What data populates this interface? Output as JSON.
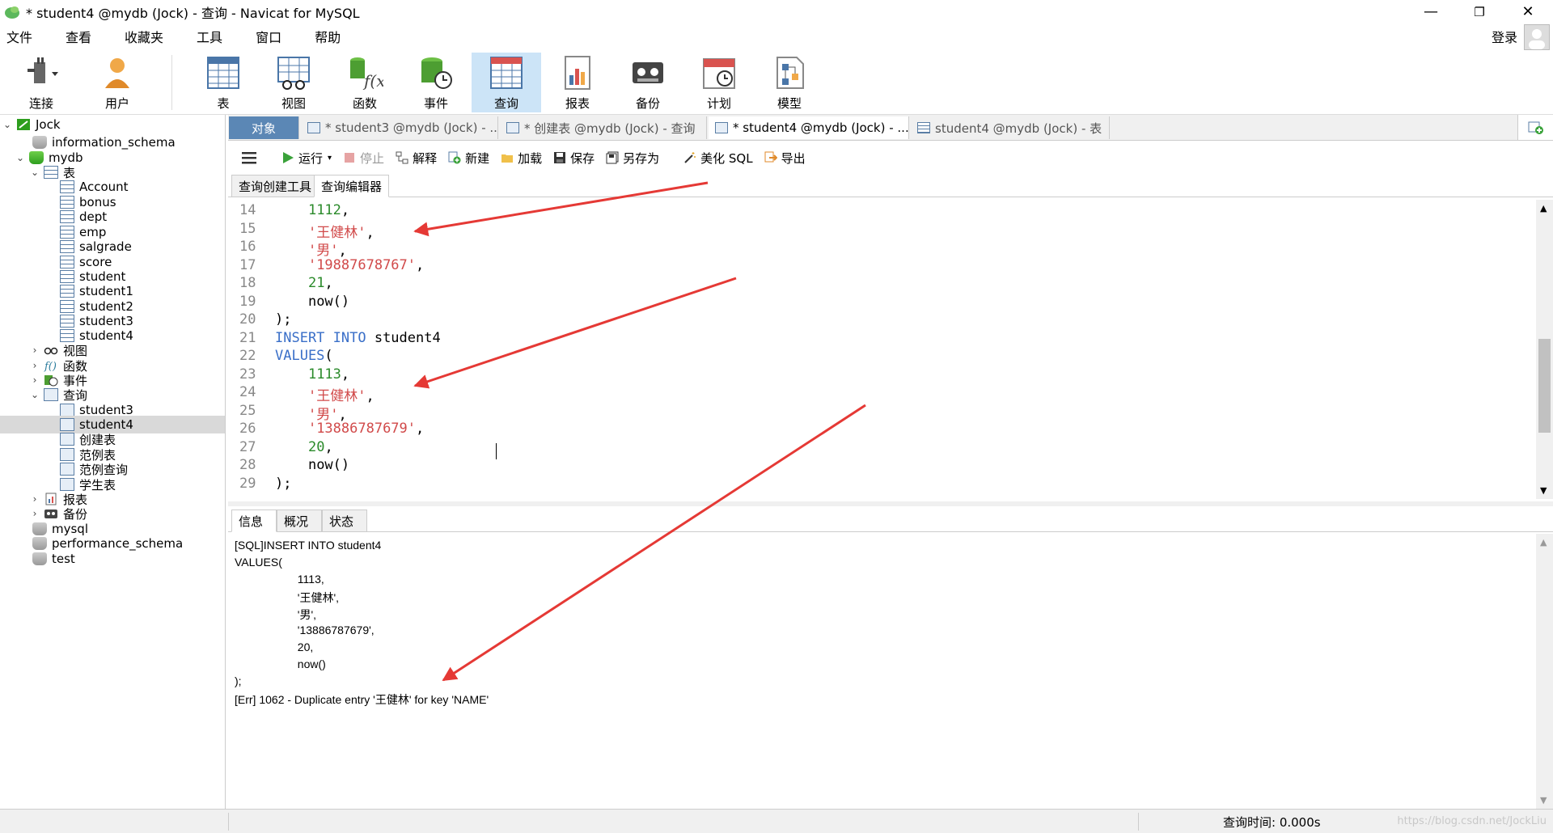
{
  "window": {
    "title": "* student4 @mydb (Jock) - 查询 - Navicat for MySQL",
    "minimize_glyph": "—",
    "restore_glyph": "❐",
    "close_glyph": "✕"
  },
  "menu": [
    "文件",
    "查看",
    "收藏夹",
    "工具",
    "窗口",
    "帮助"
  ],
  "login_label": "登录",
  "toolbar": [
    {
      "label": "连接",
      "icon": "connection-icon"
    },
    {
      "label": "用户",
      "icon": "user-icon"
    },
    {
      "label": "表",
      "icon": "table-icon"
    },
    {
      "label": "视图",
      "icon": "view-icon"
    },
    {
      "label": "函数",
      "icon": "function-icon"
    },
    {
      "label": "事件",
      "icon": "event-icon"
    },
    {
      "label": "查询",
      "icon": "query-icon",
      "active": true
    },
    {
      "label": "报表",
      "icon": "report-icon"
    },
    {
      "label": "备份",
      "icon": "backup-icon"
    },
    {
      "label": "计划",
      "icon": "schedule-icon"
    },
    {
      "label": "模型",
      "icon": "model-icon"
    }
  ],
  "tree": {
    "connection": "Jock",
    "dbs_top": [
      "information_schema"
    ],
    "db": "mydb",
    "tables_group": "表",
    "tables": [
      "Account",
      "bonus",
      "dept",
      "emp",
      "salgrade",
      "score",
      "student",
      "student1",
      "student2",
      "student3",
      "student4"
    ],
    "views_group": "视图",
    "functions_group": "函数",
    "events_group": "事件",
    "queries_group": "查询",
    "queries": [
      "student3",
      "student4",
      "创建表",
      "范例表",
      "范例查询",
      "学生表"
    ],
    "selected_query": "student4",
    "reports_group": "报表",
    "backups_group": "备份",
    "dbs_bottom": [
      "mysql",
      "performance_schema",
      "test"
    ]
  },
  "doc_tabs": {
    "objects": "对象",
    "tabs": [
      "* student3 @mydb (Jock) - ...",
      "* 创建表 @mydb (Jock) - 查询",
      "* student4 @mydb (Jock) - ...",
      "student4 @mydb (Jock) - 表"
    ]
  },
  "query_toolbar": {
    "run": "运行",
    "stop": "停止",
    "explain": "解释",
    "new": "新建",
    "load": "加载",
    "save": "保存",
    "save_as": "另存为",
    "beautify": "美化 SQL",
    "export": "导出"
  },
  "sub_tabs": [
    "查询创建工具",
    "查询编辑器"
  ],
  "editor_lines": [
    {
      "n": "14",
      "parts": [
        [
          "    ",
          ""
        ],
        [
          "1112",
          "num"
        ],
        [
          ",",
          ""
        ]
      ]
    },
    {
      "n": "15",
      "parts": [
        [
          "    ",
          ""
        ],
        [
          "'王健林'",
          "str"
        ],
        [
          ",",
          ""
        ]
      ]
    },
    {
      "n": "16",
      "parts": [
        [
          "    ",
          ""
        ],
        [
          "'男'",
          "str"
        ],
        [
          ",",
          ""
        ]
      ]
    },
    {
      "n": "17",
      "parts": [
        [
          "    ",
          ""
        ],
        [
          "'19887678767'",
          "str"
        ],
        [
          ",",
          ""
        ]
      ]
    },
    {
      "n": "18",
      "parts": [
        [
          "    ",
          ""
        ],
        [
          "21",
          "num"
        ],
        [
          ",",
          ""
        ]
      ]
    },
    {
      "n": "19",
      "parts": [
        [
          "    ",
          ""
        ],
        [
          "now()",
          ""
        ]
      ]
    },
    {
      "n": "20",
      "parts": [
        [
          ");",
          ""
        ]
      ]
    },
    {
      "n": "21",
      "parts": [
        [
          "INSERT INTO",
          "kw"
        ],
        [
          " student4",
          ""
        ]
      ]
    },
    {
      "n": "22",
      "parts": [
        [
          "VALUES",
          "kw"
        ],
        [
          "(",
          ""
        ]
      ]
    },
    {
      "n": "23",
      "parts": [
        [
          "    ",
          ""
        ],
        [
          "1113",
          "num"
        ],
        [
          ",",
          ""
        ]
      ]
    },
    {
      "n": "24",
      "parts": [
        [
          "    ",
          ""
        ],
        [
          "'王健林'",
          "str"
        ],
        [
          ",",
          ""
        ]
      ]
    },
    {
      "n": "25",
      "parts": [
        [
          "    ",
          ""
        ],
        [
          "'男'",
          "str"
        ],
        [
          ",",
          ""
        ]
      ]
    },
    {
      "n": "26",
      "parts": [
        [
          "    ",
          ""
        ],
        [
          "'13886787679'",
          "str"
        ],
        [
          ",",
          ""
        ]
      ]
    },
    {
      "n": "27",
      "parts": [
        [
          "    ",
          ""
        ],
        [
          "20",
          "num"
        ],
        [
          ",",
          ""
        ]
      ]
    },
    {
      "n": "28",
      "parts": [
        [
          "    ",
          ""
        ],
        [
          "now()",
          ""
        ]
      ]
    },
    {
      "n": "29",
      "parts": [
        [
          ");",
          ""
        ]
      ]
    }
  ],
  "info_tabs": [
    "信息",
    "概况",
    "状态"
  ],
  "info_lines": [
    "[SQL]INSERT INTO student4",
    "VALUES(",
    "                    1113,",
    "                    '王健林',",
    "                    '男',",
    "                    '13886787679',",
    "                    20,",
    "                    now()",
    ");",
    "[Err] 1062 - Duplicate entry '王健林' for key 'NAME'"
  ],
  "status": {
    "query_time": "查询时间: 0.000s",
    "watermark": "https://blog.csdn.net/JockLiu"
  },
  "colors": {
    "active_toolbar": "#cce4f7",
    "objects_tab": "#5b87b5",
    "arrow": "#e53935",
    "string": "#d14a4a",
    "number": "#2a8a2a",
    "keyword": "#3a6fc8"
  }
}
